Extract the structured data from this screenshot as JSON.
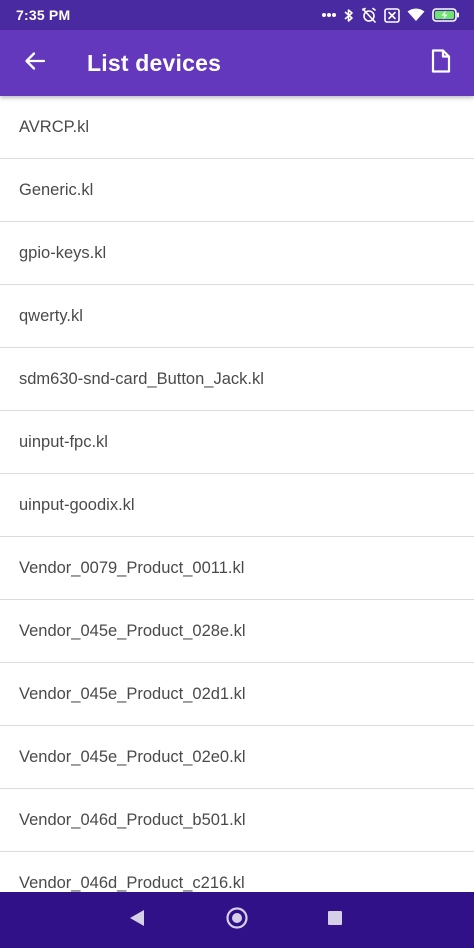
{
  "status_bar": {
    "time": "7:35 PM",
    "icons": [
      "more-dots-icon",
      "bluetooth-icon",
      "alarm-off-icon",
      "notification-x-icon",
      "wifi-icon",
      "battery-charging-icon"
    ]
  },
  "app_bar": {
    "title": "List devices",
    "back_icon": "arrow-left-icon",
    "action_icon": "file-icon"
  },
  "devices": [
    "AVRCP.kl",
    "Generic.kl",
    "gpio-keys.kl",
    "qwerty.kl",
    "sdm630-snd-card_Button_Jack.kl",
    "uinput-fpc.kl",
    "uinput-goodix.kl",
    "Vendor_0079_Product_0011.kl",
    "Vendor_045e_Product_028e.kl",
    "Vendor_045e_Product_02d1.kl",
    "Vendor_045e_Product_02e0.kl",
    "Vendor_046d_Product_b501.kl",
    "Vendor_046d_Product_c216.kl"
  ],
  "nav_bar": {
    "icons": [
      "back-triangle-icon",
      "home-circle-icon",
      "recents-square-icon"
    ]
  },
  "colors": {
    "status_bar": "#4a2aa0",
    "app_bar": "#6338bd",
    "nav_bar": "#311188",
    "list_text": "#4a4a4a",
    "divider": "#dcdcdc"
  }
}
